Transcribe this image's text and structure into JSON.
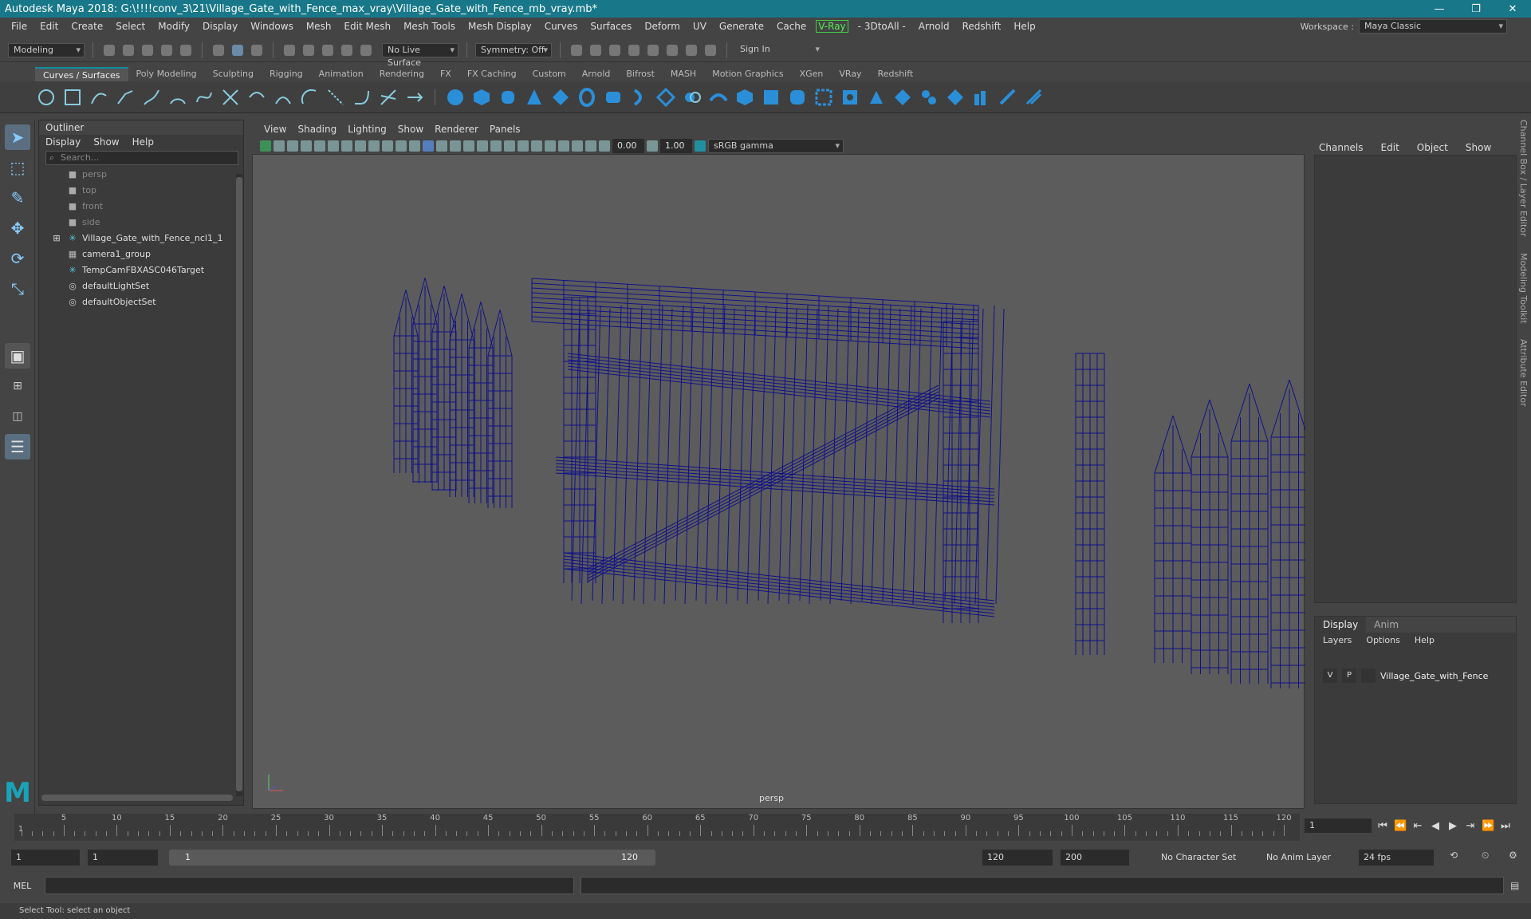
{
  "window": {
    "title": "Autodesk Maya 2018: G:\\!!!!conv_3\\21\\Village_Gate_with_Fence_max_vray\\Village_Gate_with_Fence_mb_vray.mb*",
    "minimize": "—",
    "maximize": "❐",
    "close": "✕"
  },
  "menu": [
    "File",
    "Edit",
    "Create",
    "Select",
    "Modify",
    "Display",
    "Windows",
    "Mesh",
    "Edit Mesh",
    "Mesh Tools",
    "Mesh Display",
    "Curves",
    "Surfaces",
    "Deform",
    "UV",
    "Generate",
    "Cache"
  ],
  "menu_vray": "V-Ray",
  "menu_tail": [
    "- 3DtoAll -",
    "Arnold",
    "Redshift",
    "Help"
  ],
  "workspace": {
    "label": "Workspace :",
    "value": "Maya Classic"
  },
  "status": {
    "mode": "Modeling",
    "live_surface": "No Live Surface",
    "symmetry": "Symmetry: Off",
    "sign_in": "Sign In"
  },
  "shelf_tabs": [
    "Curves / Surfaces",
    "Poly Modeling",
    "Sculpting",
    "Rigging",
    "Animation",
    "Rendering",
    "FX",
    "FX Caching",
    "Custom",
    "Arnold",
    "Bifrost",
    "MASH",
    "Motion Graphics",
    "XGen",
    "VRay",
    "Redshift"
  ],
  "outliner": {
    "title": "Outliner",
    "menu": [
      "Display",
      "Show",
      "Help"
    ],
    "search_placeholder": "Search...",
    "items": [
      {
        "label": "persp",
        "dim": true,
        "icon": "camera-icon"
      },
      {
        "label": "top",
        "dim": true,
        "icon": "camera-icon"
      },
      {
        "label": "front",
        "dim": true,
        "icon": "camera-icon"
      },
      {
        "label": "side",
        "dim": true,
        "icon": "camera-icon"
      },
      {
        "label": "Village_Gate_with_Fence_ncl1_1",
        "dim": false,
        "icon": "transform-icon"
      },
      {
        "label": "camera1_group",
        "dim": false,
        "icon": "group-icon"
      },
      {
        "label": "TempCamFBXASC046Target",
        "dim": false,
        "icon": "transform-icon"
      },
      {
        "label": "defaultLightSet",
        "dim": false,
        "icon": "set-icon"
      },
      {
        "label": "defaultObjectSet",
        "dim": false,
        "icon": "set-icon"
      }
    ]
  },
  "viewport": {
    "menu": [
      "View",
      "Shading",
      "Lighting",
      "Show",
      "Renderer",
      "Panels"
    ],
    "exposure": "0.00",
    "gamma": "1.00",
    "color_space": "sRGB gamma",
    "camera": "persp",
    "wire_color": "#10108a"
  },
  "channel_box": {
    "menu": [
      "Channels",
      "Edit",
      "Object",
      "Show"
    ]
  },
  "layers": {
    "tabs": [
      "Display",
      "Anim"
    ],
    "menu": [
      "Layers",
      "Options",
      "Help"
    ],
    "row": {
      "v": "V",
      "p": "P",
      "name": "Village_Gate_with_Fence"
    }
  },
  "side_tabs": [
    "Channel Box / Layer Editor",
    "Modeling Toolkit",
    "Attribute Editor"
  ],
  "timeline": {
    "ticks": [
      5,
      10,
      15,
      20,
      25,
      30,
      35,
      40,
      45,
      50,
      55,
      60,
      65,
      70,
      75,
      80,
      85,
      90,
      95,
      100,
      105,
      110,
      115,
      120
    ],
    "start_label": "1",
    "current_frame": "1"
  },
  "range": {
    "start": "1",
    "playback_start": "1",
    "slider_start": "1",
    "slider_end": "120",
    "playback_end": "120",
    "end": "200",
    "character_set": "No Character Set",
    "anim_layer": "No Anim Layer",
    "fps": "24 fps"
  },
  "mel": {
    "label": "MEL"
  },
  "help_line": "Select Tool: select an object"
}
